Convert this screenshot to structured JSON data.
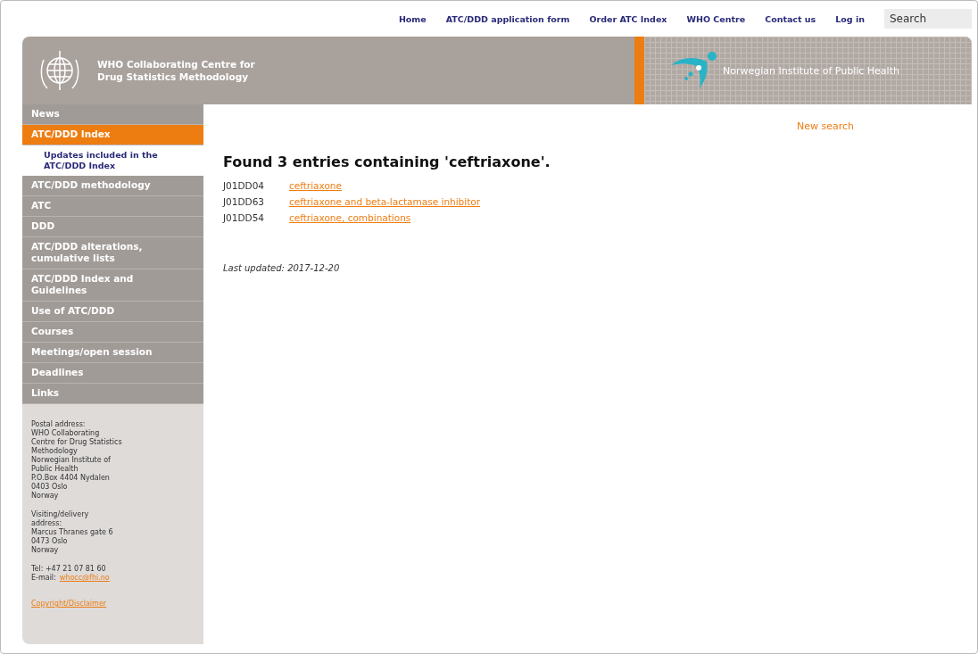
{
  "top_nav": [
    "Home",
    "ATC/DDD application form",
    "Order ATC Index",
    "WHO Centre",
    "Contact us",
    "Log in"
  ],
  "search": {
    "placeholder": "Search"
  },
  "header": {
    "title_lines": [
      "WHO Collaborating Centre for",
      "Drug Statistics Methodology"
    ],
    "partner": "Norwegian Institute of Public Health"
  },
  "sidebar": {
    "items": [
      {
        "label": "News",
        "selected": false
      },
      {
        "label": "ATC/DDD Index",
        "selected": true,
        "children": [
          {
            "label": "Updates included in the ATC/DDD Index",
            "selected": false
          }
        ]
      },
      {
        "label": "ATC/DDD methodology",
        "selected": false
      },
      {
        "label": "ATC",
        "selected": false
      },
      {
        "label": "DDD",
        "selected": false
      },
      {
        "label": "ATC/DDD alterations, cumulative lists",
        "selected": false
      },
      {
        "label": "ATC/DDD Index and Guidelines",
        "selected": false
      },
      {
        "label": "Use of ATC/DDD",
        "selected": false
      },
      {
        "label": "Courses",
        "selected": false
      },
      {
        "label": "Meetings/open session",
        "selected": false
      },
      {
        "label": "Deadlines",
        "selected": false
      },
      {
        "label": "Links",
        "selected": false
      }
    ],
    "address_blocks": [
      [
        "Postal address:",
        "WHO Collaborating",
        "Centre for Drug Statistics",
        "Methodology",
        "Norwegian Institute of",
        "Public Health",
        "P.O.Box 4404 Nydalen",
        "0403 Oslo",
        "Norway"
      ],
      [
        "Visiting/delivery",
        "address:",
        "Marcus Thranes gate 6",
        "0473 Oslo",
        "Norway"
      ]
    ],
    "phone": "Tel:  +47 21 07 81 60",
    "email_label": "E-mail:",
    "email": "whocc@fhi.no",
    "copyright": "Copyright/Disclaimer"
  },
  "main": {
    "new_search": "New search",
    "heading": "Found 3 entries containing 'ceftriaxone'.",
    "entries": [
      {
        "code": "J01DD04",
        "name": "ceftriaxone"
      },
      {
        "code": "J01DD63",
        "name": "ceftriaxone and beta-lactamase inhibitor"
      },
      {
        "code": "J01DD54",
        "name": "ceftriaxone, combinations"
      }
    ],
    "last_updated": "Last updated: 2017-12-20"
  }
}
